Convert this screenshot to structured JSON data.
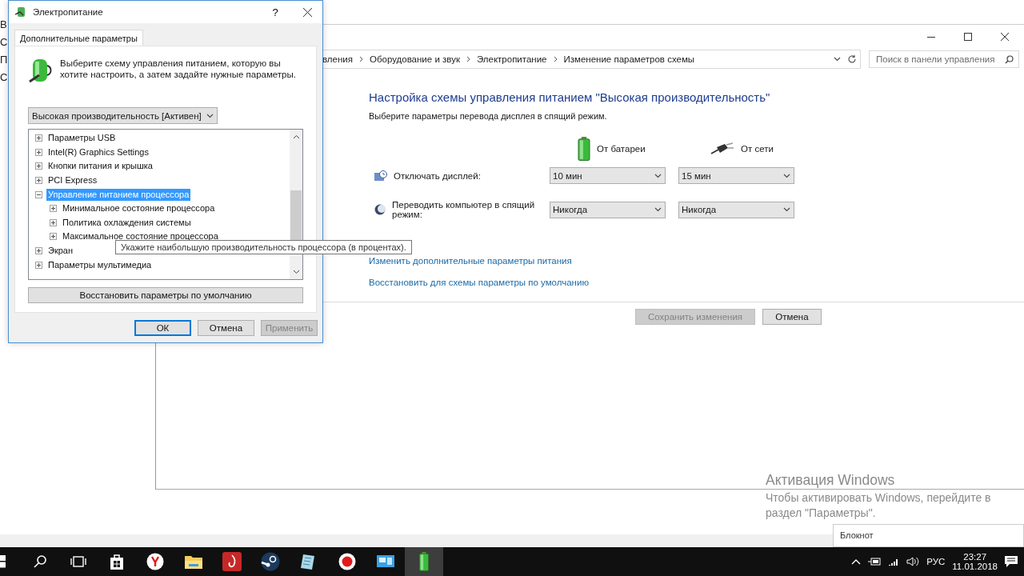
{
  "back_window": {
    "fragments": [
      "В",
      "С",
      "П",
      "С"
    ]
  },
  "control_panel": {
    "breadcrumb": [
      "вления",
      "Оборудование и звук",
      "Электропитание",
      "Изменение параметров схемы"
    ],
    "search": {
      "placeholder": "Поиск в панели управления"
    },
    "heading": "Настройка схемы управления питанием \"Высокая производительность\"",
    "subtitle": "Выберите параметры перевода дисплея в спящий режим.",
    "columns": [
      "От батареи",
      "От сети"
    ],
    "rows": [
      {
        "kind": "display",
        "label": "Отключать дисплей:",
        "values": [
          "10 мин",
          "15 мин"
        ]
      },
      {
        "kind": "sleep",
        "label": "Переводить компьютер в спящий режим:",
        "values": [
          "Никогда",
          "Никогда"
        ]
      }
    ],
    "links": [
      "Изменить дополнительные параметры питания",
      "Восстановить для схемы параметры по умолчанию"
    ],
    "buttons": [
      {
        "label": "Сохранить изменения",
        "disabled": true
      },
      {
        "label": "Отмена",
        "disabled": false
      }
    ]
  },
  "dialog": {
    "title": "Электропитание",
    "help": "?",
    "tabs": [
      {
        "label": "Дополнительные параметры",
        "selected": true
      }
    ],
    "intro": "Выберите схему управления питанием, которую вы хотите настроить, а затем задайте нужные параметры.",
    "plan": "Высокая производительность [Активен]",
    "tree": [
      {
        "label": "Параметры USB",
        "expanded": false,
        "selected": false
      },
      {
        "label": "Intel(R) Graphics Settings",
        "expanded": false,
        "selected": false
      },
      {
        "label": "Кнопки питания и крышка",
        "expanded": false,
        "selected": false
      },
      {
        "label": "PCI Express",
        "expanded": false,
        "selected": false
      },
      {
        "label": "Управление питанием процессора",
        "expanded": true,
        "selected": true,
        "children": [
          {
            "label": "Минимальное состояние процессора",
            "expanded": false,
            "selected": false
          },
          {
            "label": "Политика охлаждения системы",
            "expanded": false,
            "selected": false
          },
          {
            "label": "Максимальное состояние процессора",
            "expanded": false,
            "selected": false
          }
        ]
      },
      {
        "label": "Экран",
        "expanded": false,
        "selected": false
      },
      {
        "label": "Параметры мультимедиа",
        "expanded": false,
        "selected": false
      }
    ],
    "restore": "Восстановить параметры по умолчанию",
    "buttons": [
      {
        "label": "ОК",
        "disabled": false,
        "default": true
      },
      {
        "label": "Отмена",
        "disabled": false,
        "default": false
      },
      {
        "label": "Применить",
        "disabled": true,
        "default": false
      }
    ]
  },
  "tooltip": "Укажите наибольшую производительность процессора (в процентах).",
  "activation": {
    "title": "Активация Windows",
    "text": "Чтобы активировать Windows, перейдите в раздел \"Параметры\"."
  },
  "popup": {
    "title": "Блокнот"
  },
  "taskbar": {
    "apps": [
      {
        "kind": "search",
        "selected": false
      },
      {
        "kind": "taskview",
        "selected": false
      },
      {
        "kind": "store",
        "selected": false
      },
      {
        "kind": "yandex",
        "selected": false
      },
      {
        "kind": "folder",
        "selected": false
      },
      {
        "kind": "redapp",
        "selected": false
      },
      {
        "kind": "steam",
        "selected": false
      },
      {
        "kind": "notepad",
        "selected": false
      },
      {
        "kind": "record",
        "selected": false
      },
      {
        "kind": "monitor",
        "selected": false
      },
      {
        "kind": "battery",
        "selected": true
      }
    ],
    "language": "РУС",
    "time": "23:27",
    "date": "11.01.2018"
  }
}
